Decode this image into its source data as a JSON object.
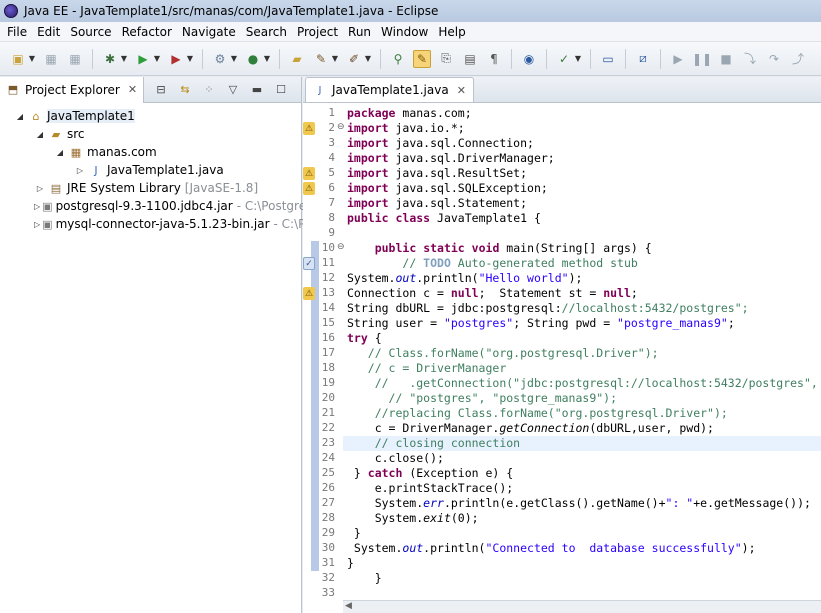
{
  "window": {
    "title": "Java EE - JavaTemplate1/src/manas/com/JavaTemplate1.java - Eclipse"
  },
  "menu": [
    "File",
    "Edit",
    "Source",
    "Refactor",
    "Navigate",
    "Search",
    "Project",
    "Run",
    "Window",
    "Help"
  ],
  "toolbar_icons": [
    "new-icon",
    "save-icon",
    "save-all-icon",
    "debug-icon",
    "run-icon",
    "external-tools-icon",
    "new-server-icon",
    "new-java-class-icon",
    "open-type-icon",
    "search-icon",
    "toggle-breadcrumb-icon",
    "mark-occurrences-icon",
    "block-selection-icon",
    "show-whitespace-icon",
    "web-browser-icon",
    "next-annotation-icon",
    "open-console-icon",
    "disconnect-icon",
    "resume-icon",
    "suspend-icon",
    "terminate-icon",
    "step-into-icon",
    "step-over-icon",
    "step-return-icon"
  ],
  "explorer": {
    "tab_label": "Project Explorer",
    "tree": [
      {
        "label": "JavaTemplate1",
        "decoration": "",
        "level": 0,
        "expanded": "open",
        "icon": "project-icon"
      },
      {
        "label": "src",
        "decoration": "",
        "level": 1,
        "expanded": "open",
        "icon": "source-folder-icon"
      },
      {
        "label": "manas.com",
        "decoration": "",
        "level": 2,
        "expanded": "open",
        "icon": "package-icon"
      },
      {
        "label": "JavaTemplate1.java",
        "decoration": "",
        "level": 3,
        "expanded": "closed",
        "icon": "java-file-icon"
      },
      {
        "label": "JRE System Library",
        "decoration": "[JavaSE-1.8]",
        "level": 1,
        "expanded": "closed",
        "icon": "library-icon"
      },
      {
        "label": "postgresql-9.3-1100.jdbc4.jar",
        "decoration": "- C:\\PostgreSQ",
        "level": 1,
        "expanded": "closed",
        "icon": "jar-icon"
      },
      {
        "label": "mysql-connector-java-5.1.23-bin.jar",
        "decoration": "- C:\\Pro",
        "level": 1,
        "expanded": "closed",
        "icon": "jar-icon"
      }
    ]
  },
  "editor": {
    "tab_label": "JavaTemplate1.java",
    "lines": [
      {
        "n": "1",
        "text": "package manas.com;"
      },
      {
        "n": "2",
        "text": "import java.io.*;"
      },
      {
        "n": "3",
        "text": "import java.sql.Connection;"
      },
      {
        "n": "4",
        "text": "import java.sql.DriverManager;"
      },
      {
        "n": "5",
        "text": "import java.sql.ResultSet;"
      },
      {
        "n": "6",
        "text": "import java.sql.SQLException;"
      },
      {
        "n": "7",
        "text": "import java.sql.Statement;"
      },
      {
        "n": "8",
        "text": "public class JavaTemplate1 {"
      },
      {
        "n": "9",
        "text": ""
      },
      {
        "n": "10",
        "text": "    public static void main(String[] args) {"
      },
      {
        "n": "11",
        "text": "        // TODO Auto-generated method stub"
      },
      {
        "n": "12",
        "text": "System.out.println(\"Hello world\");"
      },
      {
        "n": "13",
        "text": "Connection c = null;  Statement st = null;"
      },
      {
        "n": "14",
        "text": "String dbURL = \"jdbc:postgresql://localhost:5432/postgres\";"
      },
      {
        "n": "15",
        "text": "String user = \"postgres\"; String pwd = \"postgre_manas9\";"
      },
      {
        "n": "16",
        "text": "try {"
      },
      {
        "n": "17",
        "text": "   // Class.forName(\"org.postgresql.Driver\");"
      },
      {
        "n": "18",
        "text": "   // c = DriverManager"
      },
      {
        "n": "19",
        "text": "    //   .getConnection(\"jdbc:postgresql://localhost:5432/postgres\","
      },
      {
        "n": "20",
        "text": "      // \"postgres\", \"postgre_manas9\");"
      },
      {
        "n": "21",
        "text": "    //replacing Class.forName(\"org.postgresql.Driver\");"
      },
      {
        "n": "22",
        "text": "    c = DriverManager.getConnection(dbURL,user, pwd);"
      },
      {
        "n": "23",
        "text": "    // closing connection"
      },
      {
        "n": "24",
        "text": "    c.close();"
      },
      {
        "n": "25",
        "text": " } catch (Exception e) {"
      },
      {
        "n": "26",
        "text": "    e.printStackTrace();"
      },
      {
        "n": "27",
        "text": "    System.err.println(e.getClass().getName()+\": \"+e.getMessage());"
      },
      {
        "n": "28",
        "text": "    System.exit(0);"
      },
      {
        "n": "29",
        "text": " }"
      },
      {
        "n": "30",
        "text": " System.out.println(\"Connected to  database successfully\");"
      },
      {
        "n": "31",
        "text": "}"
      },
      {
        "n": "32",
        "text": "    }"
      },
      {
        "n": "33",
        "text": ""
      }
    ]
  }
}
